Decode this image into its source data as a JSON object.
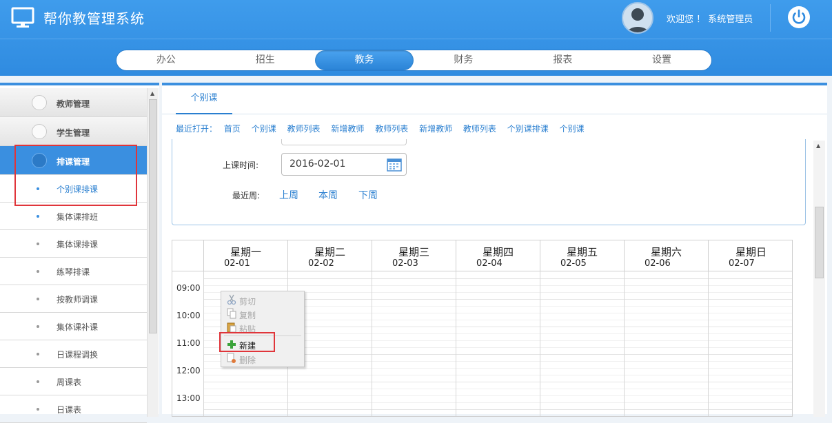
{
  "app": {
    "title": "帮你教管理系统",
    "welcome": "欢迎您 ！ 系统管理员"
  },
  "nav": {
    "items": [
      "办公",
      "招生",
      "教务",
      "财务",
      "报表",
      "设置"
    ],
    "active": "教务"
  },
  "sidebar": {
    "groups": [
      {
        "label": "教师管理"
      },
      {
        "label": "学生管理"
      },
      {
        "label": "排课管理"
      }
    ],
    "items": [
      {
        "label": "个别课排课"
      },
      {
        "label": "集体课排班"
      },
      {
        "label": "集体课排课"
      },
      {
        "label": "练琴排课"
      },
      {
        "label": "按教师调课"
      },
      {
        "label": "集体课补课"
      },
      {
        "label": "日课程调换"
      },
      {
        "label": "周课表"
      },
      {
        "label": "日课表"
      }
    ]
  },
  "main": {
    "tab": "个别课",
    "recent_label": "最近打开：",
    "recent": [
      "首页",
      "个别课",
      "教师列表",
      "新增教师",
      "教师列表",
      "新增教师",
      "教师列表",
      "个别课排课",
      "个别课"
    ],
    "form": {
      "date_label": "上课时间:",
      "date_value": "2016-02-01",
      "week_label": "最近周:",
      "week_links": [
        "上周",
        "本周",
        "下周"
      ]
    }
  },
  "calendar": {
    "days": [
      {
        "name": "星期一",
        "date": "02-01"
      },
      {
        "name": "星期二",
        "date": "02-02"
      },
      {
        "name": "星期三",
        "date": "02-03"
      },
      {
        "name": "星期四",
        "date": "02-04"
      },
      {
        "name": "星期五",
        "date": "02-05"
      },
      {
        "name": "星期六",
        "date": "02-06"
      },
      {
        "name": "星期日",
        "date": "02-07"
      }
    ],
    "times": [
      "09:00",
      "10:00",
      "11:00",
      "12:00",
      "13:00"
    ]
  },
  "context_menu": {
    "items": [
      {
        "label": "剪切",
        "icon": "scissors-icon",
        "enabled": false
      },
      {
        "label": "复制",
        "icon": "copy-icon",
        "enabled": false
      },
      {
        "label": "粘贴",
        "icon": "paste-icon",
        "enabled": false
      },
      {
        "label": "新建",
        "icon": "plus-icon",
        "enabled": true
      },
      {
        "label": "删除",
        "icon": "delete-icon",
        "enabled": false
      }
    ]
  },
  "colors": {
    "primary": "#3a8fe0",
    "highlight": "#e0353a"
  }
}
